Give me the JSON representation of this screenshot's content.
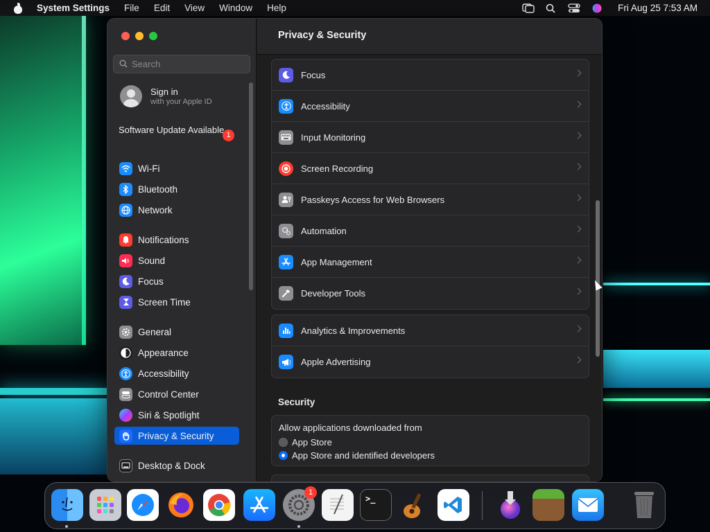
{
  "menubar": {
    "app_name": "System Settings",
    "items": [
      "File",
      "Edit",
      "View",
      "Window",
      "Help"
    ],
    "clock": "Fri Aug 25  7:53 AM"
  },
  "sidebar": {
    "search_placeholder": "Search",
    "signin": {
      "title": "Sign in",
      "subtitle": "with your Apple ID"
    },
    "update": {
      "label": "Software Update Available",
      "badge": "1"
    },
    "items": [
      {
        "label": "Wi-Fi",
        "icon": "wifi-icon",
        "color": "#1a8cff"
      },
      {
        "label": "Bluetooth",
        "icon": "bluetooth-icon",
        "color": "#1a8cff"
      },
      {
        "label": "Network",
        "icon": "globe-icon",
        "color": "#1a8cff"
      },
      {
        "label": "Notifications",
        "icon": "bell-icon",
        "color": "#ff3b30"
      },
      {
        "label": "Sound",
        "icon": "speaker-icon",
        "color": "#ff2d55"
      },
      {
        "label": "Focus",
        "icon": "moon-icon",
        "color": "#5e5ce6"
      },
      {
        "label": "Screen Time",
        "icon": "hourglass-icon",
        "color": "#5e5ce6"
      },
      {
        "label": "General",
        "icon": "gear-icon",
        "color": "#8e8e93"
      },
      {
        "label": "Appearance",
        "icon": "appearance-icon",
        "color": "#1c1c1e"
      },
      {
        "label": "Accessibility",
        "icon": "accessibility-icon",
        "color": "#1a8cff"
      },
      {
        "label": "Control Center",
        "icon": "control-center-icon",
        "color": "#8e8e93"
      },
      {
        "label": "Siri & Spotlight",
        "icon": "siri-icon",
        "color": "#6a3df0"
      },
      {
        "label": "Privacy & Security",
        "icon": "hand-icon",
        "color": "#1a6cff"
      },
      {
        "label": "Desktop & Dock",
        "icon": "desktop-icon",
        "color": "#1c1c1e"
      }
    ]
  },
  "main": {
    "title": "Privacy & Security",
    "group1": [
      {
        "label": "Focus",
        "icon": "moon-icon",
        "color": "#5e5ce6"
      },
      {
        "label": "Accessibility",
        "icon": "accessibility-icon",
        "color": "#1a8cff"
      },
      {
        "label": "Input Monitoring",
        "icon": "keyboard-icon",
        "color": "#8e8e93"
      },
      {
        "label": "Screen Recording",
        "icon": "record-icon",
        "color": "#ff3b30"
      },
      {
        "label": "Passkeys Access for Web Browsers",
        "icon": "passkey-icon",
        "color": "#8e8e93"
      },
      {
        "label": "Automation",
        "icon": "gears-icon",
        "color": "#8e8e93"
      },
      {
        "label": "App Management",
        "icon": "app-store-icon",
        "color": "#1a8cff"
      },
      {
        "label": "Developer Tools",
        "icon": "hammer-icon",
        "color": "#8e8e93"
      }
    ],
    "group2": [
      {
        "label": "Analytics & Improvements",
        "icon": "chart-icon",
        "color": "#1a8cff"
      },
      {
        "label": "Apple Advertising",
        "icon": "megaphone-icon",
        "color": "#1a8cff"
      }
    ],
    "security": {
      "title": "Security",
      "allow_label": "Allow applications downloaded from",
      "options": [
        "App Store",
        "App Store and identified developers"
      ],
      "selected": "App Store and identified developers"
    }
  },
  "dock": {
    "apps": [
      "Finder",
      "Launchpad",
      "Safari",
      "Firefox",
      "Chrome",
      "App Store",
      "System Settings",
      "TextEdit",
      "Terminal",
      "GarageBand",
      "Visual Studio Code",
      "Installer",
      "Minecraft",
      "Mail",
      "Trash"
    ],
    "settings_badge": "1"
  }
}
